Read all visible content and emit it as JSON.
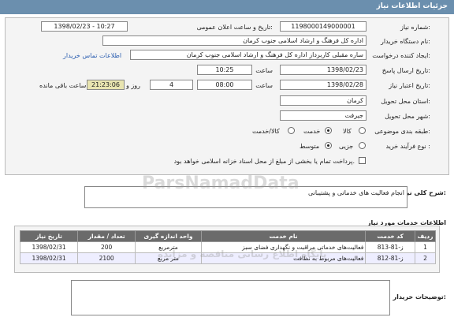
{
  "header": {
    "title": "جزئیات اطلاعات نیاز"
  },
  "fields": {
    "need_number_label": "شماره نیاز:",
    "need_number": "1198000149000001",
    "announce_label": "تاریخ و ساعت اعلان عمومی:",
    "announce_value": "1398/02/23 - 10:27",
    "buyer_org_label": "نام دستگاه خریدار:",
    "buyer_org": "اداره کل فرهنگ و ارشاد اسلامی جنوب کرمان",
    "creator_label": "ایجاد کننده درخواست:",
    "creator": "ساره مقبلی کاربرداز اداره کل فرهنگ و ارشاد اسلامی جنوب کرمان",
    "contact_link": "اطلاعات تماس خریدار",
    "reply_deadline_label": "تاریخ ارسال پاسخ:",
    "reply_date": "1398/02/23",
    "time_label": "ساعت",
    "reply_time": "10:25",
    "validity_label": "تاریخ اعتبار نیاز:",
    "validity_date": "1398/02/28",
    "validity_time": "08:00",
    "days_value": "4",
    "days_label": "روز و",
    "remaining_time": "21:23:06",
    "remaining_label": "ساعت باقی مانده",
    "province_label": "استان محل تحویل:",
    "province": "کرمان",
    "city_label": "شهر محل تحویل:",
    "city": "جیرفت",
    "category_label": "طبقه بندی موضوعی:",
    "category_options": [
      "کالا",
      "خدمت",
      "کالا/خدمت"
    ],
    "category_selected": "خدمت",
    "process_label": "نوع فرآیند خرید :",
    "process_options": [
      "جزیی",
      "متوسط"
    ],
    "process_selected": "متوسط",
    "process_note": "پرداخت تمام یا بخشی از مبلغ از محل اسناد خزانه اسلامی خواهد بود."
  },
  "summary": {
    "label": "شرح کلی نیاز:",
    "value": "انجام فعالیت های خدماتی و پشتیبانی"
  },
  "services": {
    "title": "اطلاعات خدمات مورد نیاز",
    "columns": [
      "ردیف",
      "کد خدمت",
      "نام خدمت",
      "واحد اندازه گیری",
      "تعداد / مقدار",
      "تاریخ نیاز"
    ],
    "rows": [
      [
        "1",
        "ز-81-813",
        "فعالیت‌های خدماتی مراقبت و نگهداری فضای سبز",
        "مترمربع",
        "200",
        "1398/02/31"
      ],
      [
        "2",
        "ز-81-812",
        "فعالیت‌های مربوط به نظافت",
        "متر مربع",
        "2100",
        "1398/02/31"
      ]
    ]
  },
  "buyer_notes": {
    "label": "توضیحات خریدار:",
    "value": ""
  },
  "watermark": {
    "text1": "ParsNamadData",
    "text2": "پایگاه اطلاع رسانی مناقصه و مزایده"
  }
}
